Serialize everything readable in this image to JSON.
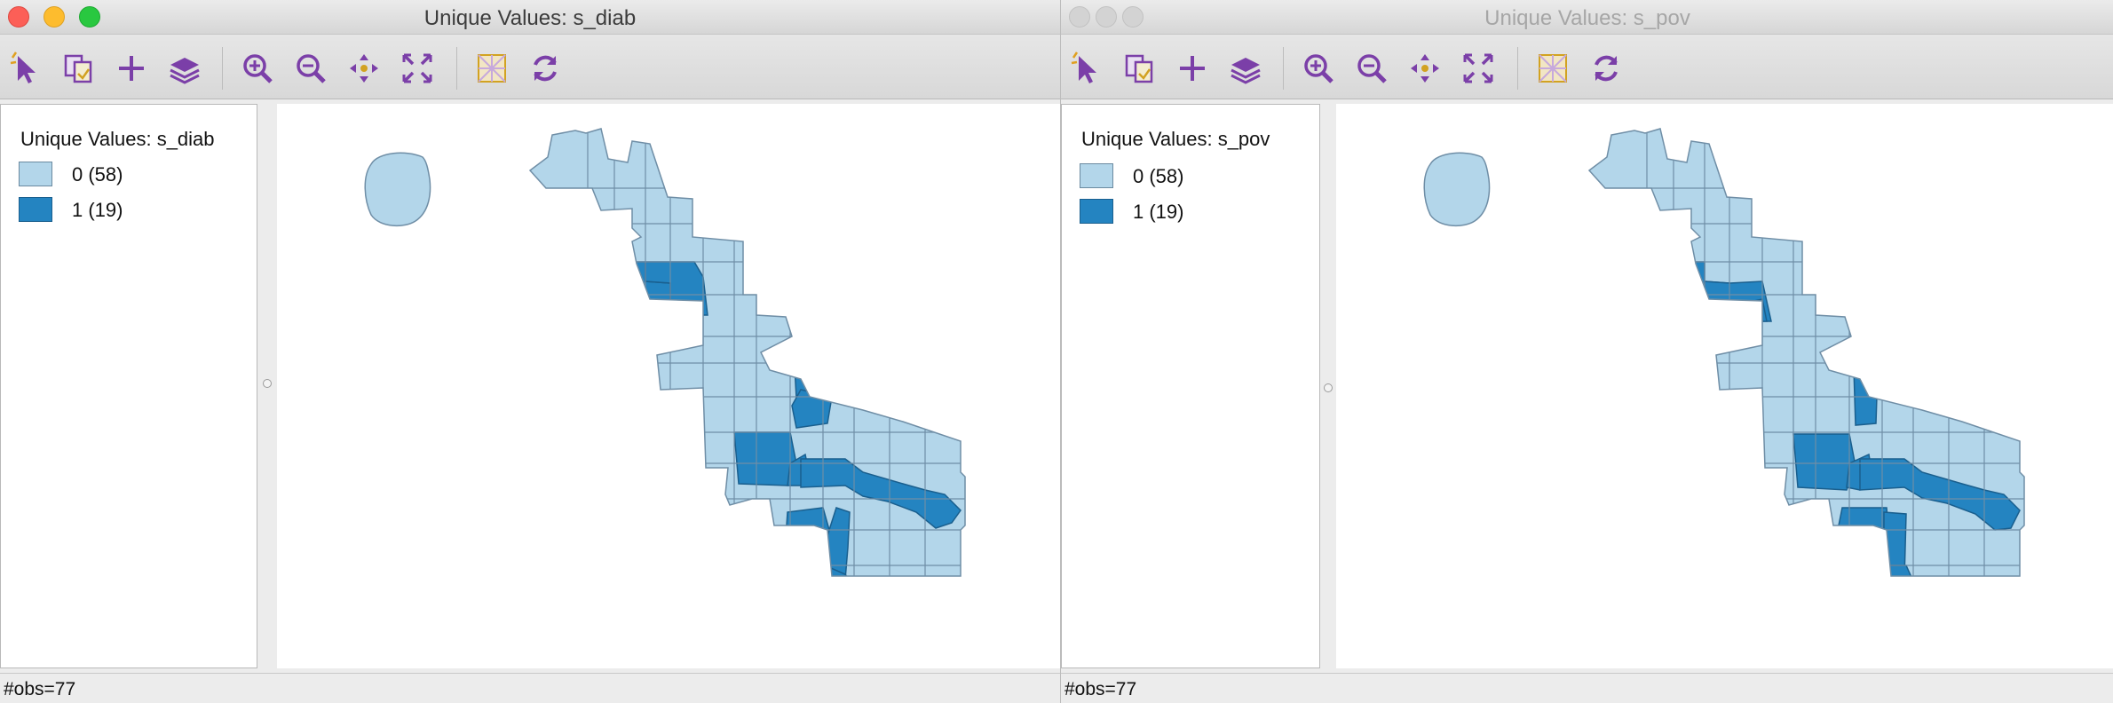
{
  "colors": {
    "class_0": "#b3d6ea",
    "class_1": "#2484c1",
    "border": "#6f8ea6",
    "toolbar_icon": "#7b3fa8"
  },
  "windows": [
    {
      "title": "Unique Values: s_diab",
      "toolbar": [
        {
          "icon": "select-arrow-icon"
        },
        {
          "icon": "copy-selection-icon"
        },
        {
          "icon": "add-plus-icon"
        },
        {
          "icon": "layers-icon"
        },
        {
          "icon": "zoom-in-icon"
        },
        {
          "icon": "zoom-out-icon"
        },
        {
          "icon": "pan-icon"
        },
        {
          "icon": "fit-extent-icon"
        },
        {
          "icon": "select-grid-icon"
        },
        {
          "icon": "refresh-icon"
        }
      ],
      "legend": {
        "title": "Unique Values: s_diab",
        "items": [
          {
            "label": "0 (58)",
            "value": 0,
            "count": 58
          },
          {
            "label": "1 (19)",
            "value": 1,
            "count": 19
          }
        ]
      },
      "status": "#obs=77"
    },
    {
      "title": "Unique Values: s_pov",
      "toolbar": [
        {
          "icon": "select-arrow-icon"
        },
        {
          "icon": "copy-selection-icon"
        },
        {
          "icon": "add-plus-icon"
        },
        {
          "icon": "layers-icon"
        },
        {
          "icon": "zoom-in-icon"
        },
        {
          "icon": "zoom-out-icon"
        },
        {
          "icon": "pan-icon"
        },
        {
          "icon": "fit-extent-icon"
        },
        {
          "icon": "select-grid-icon"
        },
        {
          "icon": "refresh-icon"
        }
      ],
      "legend": {
        "title": "Unique Values: s_pov",
        "items": [
          {
            "label": "0 (58)",
            "value": 0,
            "count": 58
          },
          {
            "label": "1 (19)",
            "value": 1,
            "count": 19
          }
        ]
      },
      "status": "#obs=77"
    }
  ]
}
